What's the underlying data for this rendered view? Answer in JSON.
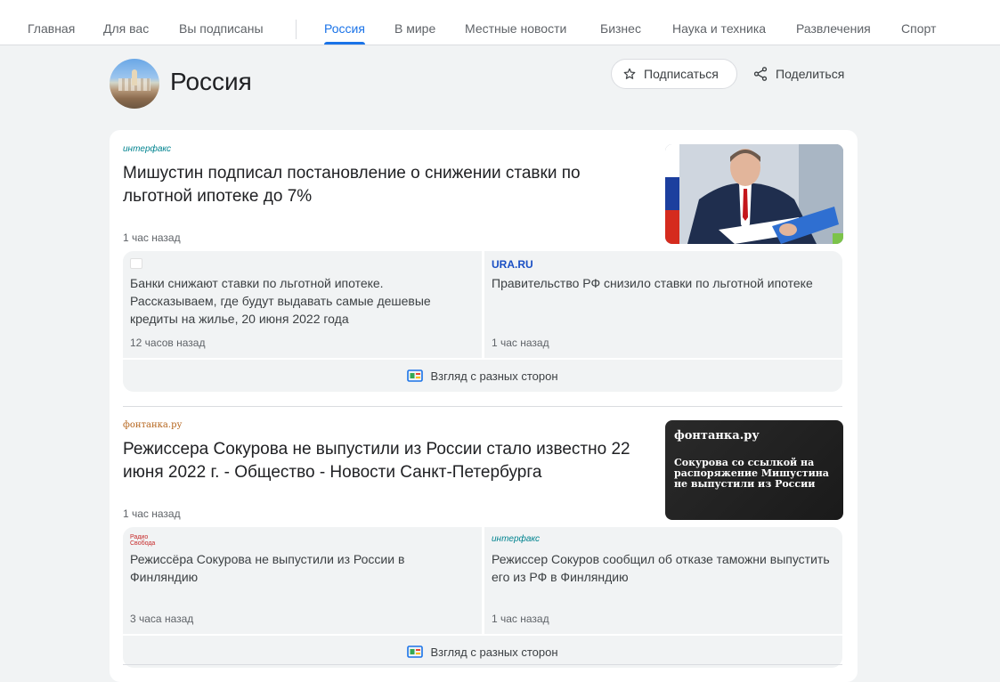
{
  "nav": {
    "tabs": [
      {
        "label": "Главная"
      },
      {
        "label": "Для вас"
      },
      {
        "label": "Вы подписаны"
      },
      {
        "label": "Россия",
        "active": true
      },
      {
        "label": "В мире"
      },
      {
        "label": "Местные новости"
      },
      {
        "label": "Бизнес"
      },
      {
        "label": "Наука и техника"
      },
      {
        "label": "Развлечения"
      },
      {
        "label": "Спорт"
      }
    ]
  },
  "header": {
    "title": "Россия",
    "subscribe_label": "Подписаться",
    "share_label": "Поделиться"
  },
  "stories": [
    {
      "source": "интерфакс",
      "headline": "Мишустин подписал постановление о снижении ставки по льготной ипотеке до 7%",
      "time": "1 час назад",
      "related": [
        {
          "source": "",
          "text": "Банки снижают ставки по льготной ипотеке. Рассказываем, где будут выдавать самые дешевые кредиты на жилье, 20 июня 2022 года",
          "time": "12 часов назад"
        },
        {
          "source": "URA.RU",
          "text": "Правительство РФ снизило ставки по льготной ипотеке",
          "time": "1 час назад"
        }
      ],
      "perspectives_label": "Взгляд с разных сторон"
    },
    {
      "source": "фонтанка.ру",
      "headline": "Режиссера Сокурова не выпустили из России стало известно 22 июня 2022 г. - Общество - Новости Санкт-Петербурга",
      "time": "1 час назад",
      "thumb_logo": "фонтанка.ру",
      "thumb_text": "Сокурова со ссылкой на распоряжение Мишустина не выпустили из России",
      "related": [
        {
          "source": "Радио Свобода",
          "text": "Режиссёра Сокурова не выпустили из России в Финляндию",
          "time": "3 часа назад"
        },
        {
          "source": "интерфакс",
          "text": "Режиссер Сокуров сообщил об отказе таможни выпустить его из РФ в Финляндию",
          "time": "1 час назад"
        }
      ],
      "perspectives_label": "Взгляд с разных сторон"
    }
  ],
  "colors": {
    "accent": "#1a73e8",
    "interfax": "#00838f",
    "ura": "#1a4fc4",
    "fontanka": "#b5651d"
  }
}
